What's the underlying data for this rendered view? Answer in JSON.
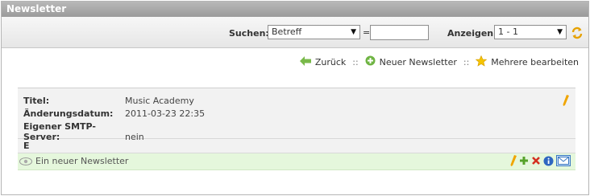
{
  "window": {
    "title": "Newsletter"
  },
  "toolbar": {
    "search_label": "Suchen:",
    "search_field_value": "Betreff",
    "equals": "=",
    "search_value": "",
    "show_label": "Anzeigen:",
    "show_value": "1 - 1"
  },
  "actions": {
    "back": "Zurück",
    "new_newsletter": "Neuer Newsletter",
    "edit_multiple": "Mehrere bearbeiten",
    "separator": "::"
  },
  "newsletter": {
    "title_label": "Titel:",
    "title_value": "Music Academy",
    "changed_label": "Änderungsdatum:",
    "changed_value": "2011-03-23 22:35",
    "smtp_label": "Eigener SMTP-Server:",
    "smtp_value": "nein"
  },
  "group": {
    "letter": "E"
  },
  "rows": [
    {
      "name": "Ein neuer Newsletter"
    }
  ],
  "colors": {
    "titlebar": "#a8a8a8",
    "row_highlight": "#e5f7dc",
    "info_bg": "#f2f2f2"
  }
}
